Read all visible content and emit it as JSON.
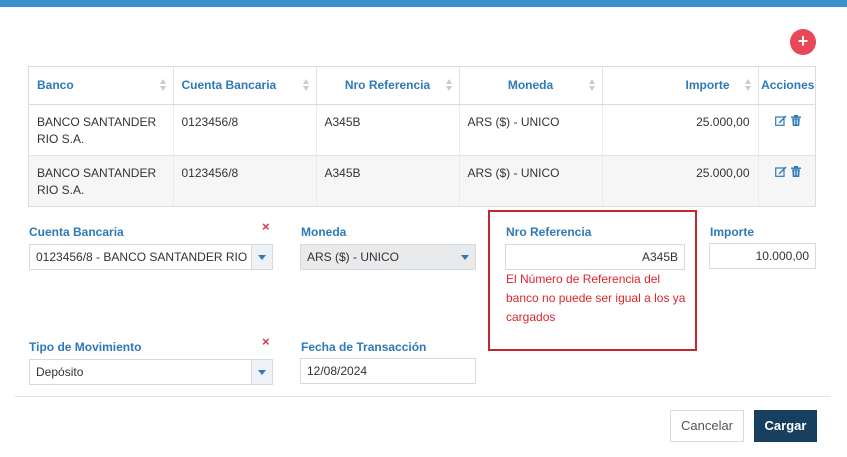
{
  "add_button": {
    "icon": "plus-icon",
    "glyph": "+",
    "color": "#e84857"
  },
  "table": {
    "columns": [
      "Banco",
      "Cuenta Bancaria",
      "Nro Referencia",
      "Moneda",
      "Importe",
      "Acciones"
    ],
    "rows": [
      {
        "banco": "BANCO SANTANDER RIO S.A.",
        "cuenta": "0123456/8",
        "referencia": "A345B",
        "moneda": "ARS ($) - UNICO",
        "importe": "25.000,00"
      },
      {
        "banco": "BANCO SANTANDER RIO S.A.",
        "cuenta": "0123456/8",
        "referencia": "A345B",
        "moneda": "ARS ($) - UNICO",
        "importe": "25.000,00"
      }
    ],
    "action_icons": [
      "edit-icon",
      "trash-icon"
    ]
  },
  "form": {
    "cuenta_bancaria": {
      "label": "Cuenta Bancaria",
      "value": "0123456/8 - BANCO SANTANDER RIO ..."
    },
    "moneda": {
      "label": "Moneda",
      "value": "ARS ($) - UNICO"
    },
    "nro_referencia": {
      "label": "Nro Referencia",
      "value": "A345B",
      "error": "El Número de Referencia del banco no puede ser igual a los ya cargados"
    },
    "importe": {
      "label": "Importe",
      "value": "10.000,00"
    },
    "tipo_movimiento": {
      "label": "Tipo de Movimiento",
      "value": "Depósito"
    },
    "fecha_transaccion": {
      "label": "Fecha de Transacción",
      "value": "12/08/2024"
    },
    "clear_glyph": "×"
  },
  "buttons": {
    "cancel": "Cancelar",
    "submit": "Cargar"
  },
  "colors": {
    "accent": "#2e79b8",
    "topbar": "#3d8fce",
    "error": "#e0242b",
    "primary_button": "#173f5f"
  }
}
